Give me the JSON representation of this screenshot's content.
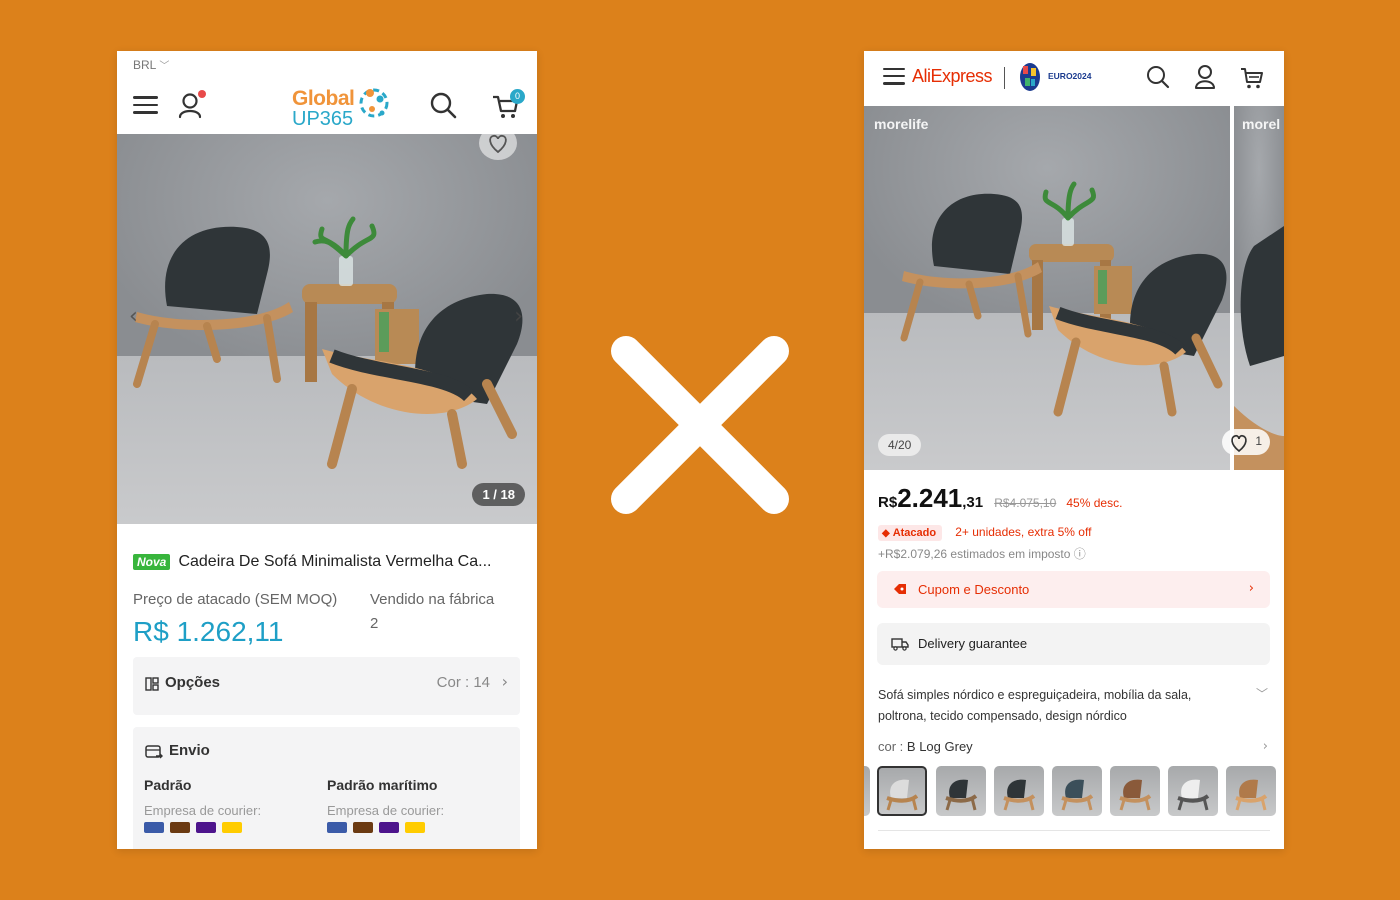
{
  "left_app": {
    "currency": "BRL",
    "logo": {
      "line1": "Global",
      "line2": "UP365"
    },
    "cart_count": "0",
    "gallery": {
      "counter": "1 / 18"
    },
    "product": {
      "new_badge": "Nova",
      "title": "Cadeira De Sofá Minimalista Vermelha Ca..."
    },
    "price_label": "Preço de atacado (SEM MOQ)",
    "price": "R$ 1.262,11",
    "sold_label": "Vendido na fábrica",
    "sold_value": "2",
    "options": {
      "label": "Opções",
      "value": "Cor : 14"
    },
    "shipping": {
      "label": "Envio",
      "standard": {
        "name": "Padrão",
        "courier_label": "Empresa de courier:"
      },
      "sea": {
        "name": "Padrão marítimo",
        "courier_label": "Empresa de courier:"
      },
      "carrier_colors": [
        "#3B5BA8",
        "#6B3A12",
        "#4D148C",
        "#FFCC00"
      ]
    }
  },
  "right_app": {
    "logo": "AliExpress",
    "euro_text": "EURO2024",
    "gallery": {
      "brand": "morelife",
      "brand_next": "morel",
      "counter": "4/20",
      "likes": "1"
    },
    "price": {
      "currency": "R$",
      "integer": "2.241",
      "decimal": ",31",
      "original": "R$4.075,10",
      "discount": "45% desc."
    },
    "wholesale": {
      "badge": "Atacado",
      "text": "2+ unidades, extra 5% off"
    },
    "tax_note": "+R$2.079,26 estimados em imposto ⓘ",
    "coupon_label": "Cupom e Desconto",
    "delivery_label": "Delivery guarantee",
    "description": "Sofá simples nórdico e espreguiçadeira, mobília da sala, poltrona, tecido compensado, design nórdico",
    "color": {
      "key": "cor :",
      "value": "B Log Grey"
    },
    "accent_color": "#E62E04"
  },
  "center_icon": "x-icon",
  "background_color": "#DC811B"
}
